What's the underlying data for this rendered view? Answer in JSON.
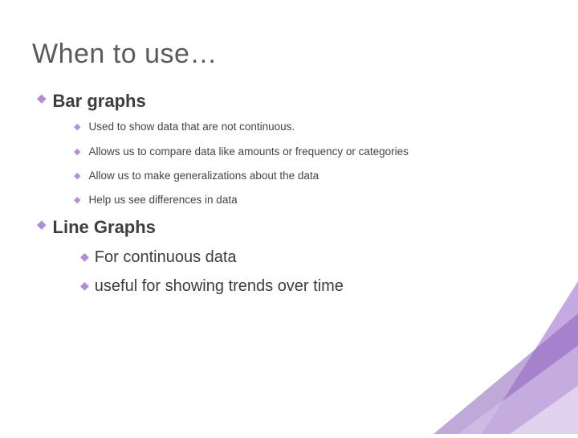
{
  "title": "When to use…",
  "section1": {
    "heading_prefix": "Bar",
    "heading_rest": " graphs",
    "items": [
      "Used to show data that are not continuous.",
      "Allows us to compare data like amounts or frequency or categories",
      "Allow us to make generalizations about the data",
      "Help us see differences in data"
    ]
  },
  "section2": {
    "heading_prefix": "Line",
    "heading_rest": " Graphs",
    "items": [
      {
        "prefix": "For",
        "rest": " continuous data"
      },
      {
        "prefix": "useful",
        "rest": " for showing trends over time"
      }
    ]
  }
}
